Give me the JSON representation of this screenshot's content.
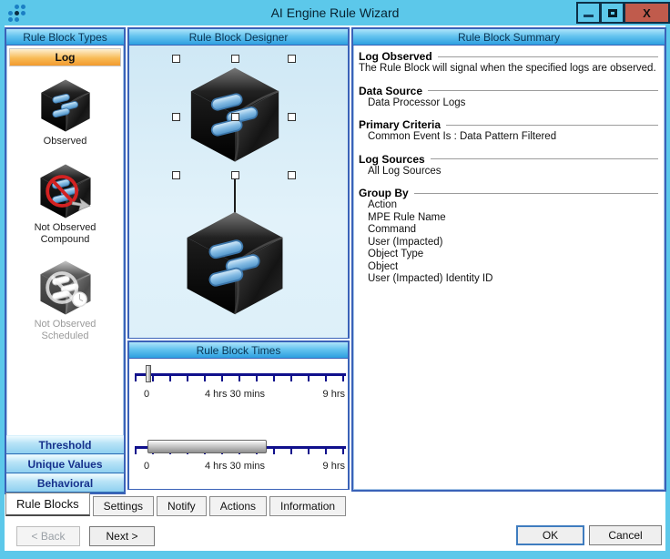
{
  "window": {
    "title": "AI Engine Rule Wizard",
    "controls": {
      "close_glyph": "X"
    }
  },
  "left_panel": {
    "header": "Rule Block Types",
    "log_button": "Log",
    "types": [
      {
        "label": "Observed"
      },
      {
        "label": "Not Observed Compound"
      },
      {
        "label": "Not Observed Scheduled"
      }
    ],
    "bottom_buttons": [
      "Threshold",
      "Unique Values",
      "Behavioral"
    ]
  },
  "designer": {
    "header": "Rule Block Designer"
  },
  "times": {
    "header": "Rule Block Times",
    "slider1": {
      "labels": [
        "0",
        "4 hrs 30 mins",
        "9 hrs"
      ]
    },
    "slider2": {
      "labels": [
        "0",
        "4 hrs 30 mins",
        "9 hrs"
      ]
    }
  },
  "summary": {
    "header": "Rule Block Summary",
    "sections": [
      {
        "title": "Log Observed",
        "lines": [
          "The Rule Block will signal when the specified logs are observed."
        ]
      },
      {
        "title": "Data Source",
        "lines": [
          "Data Processor Logs"
        ]
      },
      {
        "title": "Primary Criteria",
        "lines": [
          "Common Event Is : Data Pattern Filtered"
        ]
      },
      {
        "title": "Log Sources",
        "lines": [
          "All Log Sources"
        ]
      },
      {
        "title": "Group By",
        "lines": [
          "Action",
          "MPE Rule Name",
          "Command",
          "User (Impacted)",
          "Object Type",
          "Object",
          "User (Impacted) Identity ID"
        ]
      }
    ]
  },
  "tabs": [
    "Rule Blocks",
    "Settings",
    "Notify",
    "Actions",
    "Information"
  ],
  "nav": {
    "back": "< Back",
    "next": "Next >"
  },
  "dialog_buttons": {
    "ok": "OK",
    "cancel": "Cancel"
  },
  "colors": {
    "frame_blue": "#5CC8EA",
    "header_gradient_bottom": "#2D9FE0",
    "accent_orange": "#F29A2E",
    "close_red": "#C05B4C",
    "slider_navy": "#10108C",
    "panel_border": "#3A62B8"
  }
}
